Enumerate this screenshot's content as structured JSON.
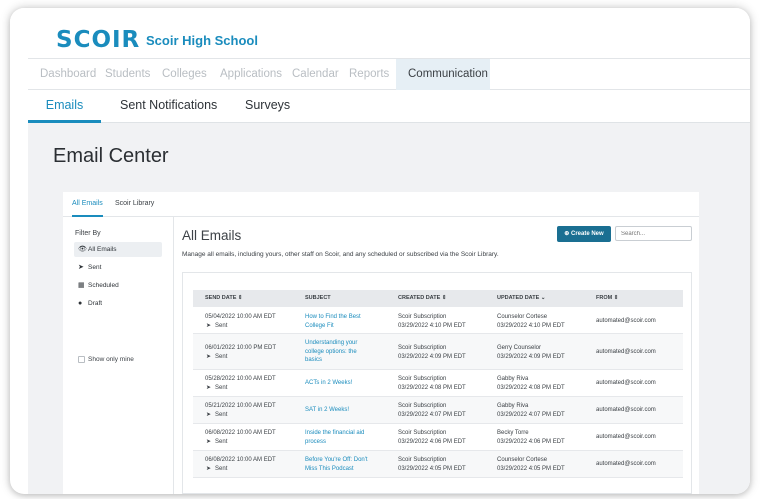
{
  "brand": {
    "logo": "SCOIR",
    "school": "Scoir High School",
    "accent": "#1a8cbd"
  },
  "main_nav": [
    "Dashboard",
    "Students",
    "Colleges",
    "Applications",
    "Calendar",
    "Reports",
    "Communication"
  ],
  "sub_nav": [
    "Emails",
    "Sent Notifications",
    "Surveys"
  ],
  "page_title": "Email Center",
  "panel_tabs": [
    "All Emails",
    "Scoir Library"
  ],
  "filter": {
    "title": "Filter By",
    "items": [
      {
        "label": "All Emails",
        "icon": "eye-icon"
      },
      {
        "label": "Sent",
        "icon": "paper-plane-icon"
      },
      {
        "label": "Scheduled",
        "icon": "calendar-icon"
      },
      {
        "label": "Draft",
        "icon": "minus-circle-icon"
      }
    ],
    "only_mine": "Show only mine"
  },
  "emails": {
    "title": "All Emails",
    "description": "Manage all emails, including yours, other staff on Scoir, and any scheduled or subscribed via the Scoir Library.",
    "create_label": "Create New",
    "search_placeholder": "Search..."
  },
  "table": {
    "columns": [
      "SEND DATE",
      "SUBJECT",
      "CREATED DATE",
      "UPDATED DATE",
      "FROM"
    ],
    "rows": [
      {
        "send_date": "05/04/2022 10:00 AM EDT",
        "status": "Sent",
        "subject_1": "How to Find the Best",
        "subject_2": "College Fit",
        "subject_3": "",
        "created_by": "Scoir Subscription",
        "created_date": "03/29/2022 4:10 PM EDT",
        "updated_by": "Counselor Cortese",
        "updated_date": "03/29/2022 4:10 PM EDT",
        "from": "automated@scoir.com"
      },
      {
        "send_date": "06/01/2022 10:00 PM EDT",
        "status": "Sent",
        "subject_1": "Understanding your",
        "subject_2": "college options: the",
        "subject_3": "basics",
        "created_by": "Scoir Subscription",
        "created_date": "03/29/2022 4:09 PM EDT",
        "updated_by": "Gerry Counselor",
        "updated_date": "03/29/2022 4:09 PM EDT",
        "from": "automated@scoir.com"
      },
      {
        "send_date": "05/28/2022 10:00 AM EDT",
        "status": "Sent",
        "subject_1": "ACTs in 2 Weeks!",
        "subject_2": "",
        "subject_3": "",
        "created_by": "Scoir Subscription",
        "created_date": "03/29/2022 4:08 PM EDT",
        "updated_by": "Gabby Riva",
        "updated_date": "03/29/2022 4:08 PM EDT",
        "from": "automated@scoir.com"
      },
      {
        "send_date": "05/21/2022 10:00 AM EDT",
        "status": "Sent",
        "subject_1": "SAT in 2 Weeks!",
        "subject_2": "",
        "subject_3": "",
        "created_by": "Scoir Subscription",
        "created_date": "03/29/2022 4:07 PM EDT",
        "updated_by": "Gabby Riva",
        "updated_date": "03/29/2022 4:07 PM EDT",
        "from": "automated@scoir.com"
      },
      {
        "send_date": "06/08/2022 10:00 AM EDT",
        "status": "Sent",
        "subject_1": "Inside the financial aid",
        "subject_2": "process",
        "subject_3": "",
        "created_by": "Scoir Subscription",
        "created_date": "03/29/2022 4:06 PM EDT",
        "updated_by": "Becky Torre",
        "updated_date": "03/29/2022 4:06 PM EDT",
        "from": "automated@scoir.com"
      },
      {
        "send_date": "06/08/2022 10:00 AM EDT",
        "status": "Sent",
        "subject_1": "Before You're Off: Don't",
        "subject_2": "Miss This Podcast",
        "subject_3": "",
        "created_by": "Scoir Subscription",
        "created_date": "03/29/2022 4:05 PM EDT",
        "updated_by": "Counselor Cortese",
        "updated_date": "03/29/2022 4:05 PM EDT",
        "from": "automated@scoir.com"
      }
    ]
  }
}
